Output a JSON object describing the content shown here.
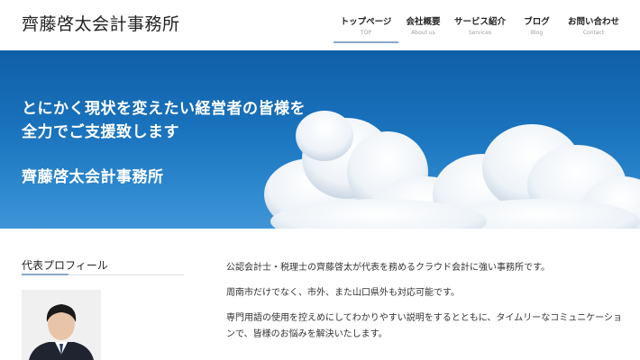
{
  "header": {
    "site_title": "齊藤啓太会計事務所",
    "nav": [
      {
        "label": "トップページ",
        "sub": "TOP"
      },
      {
        "label": "会社概要",
        "sub": "About us"
      },
      {
        "label": "サービス紹介",
        "sub": "Services"
      },
      {
        "label": "ブログ",
        "sub": "Blog"
      },
      {
        "label": "お問い合わせ",
        "sub": "Contact"
      }
    ]
  },
  "hero": {
    "line1": "とにかく現状を変えたい経営者の皆様を",
    "line2": "全力でご支援致します",
    "line3": "齊藤啓太会計事務所"
  },
  "profile": {
    "heading": "代表プロフィール"
  },
  "intro": {
    "p1": "公認会計士・税理士の齊藤啓太が代表を務めるクラウド会計に強い事務所です。",
    "p2": "周南市だけでなく、市外、また山口県外も対応可能です。",
    "p3": "専門用語の使用を控えめにしてわかりやすい説明をするとともに、タイムリーなコミュニケーションで、皆様のお悩みを解決いたします。"
  }
}
